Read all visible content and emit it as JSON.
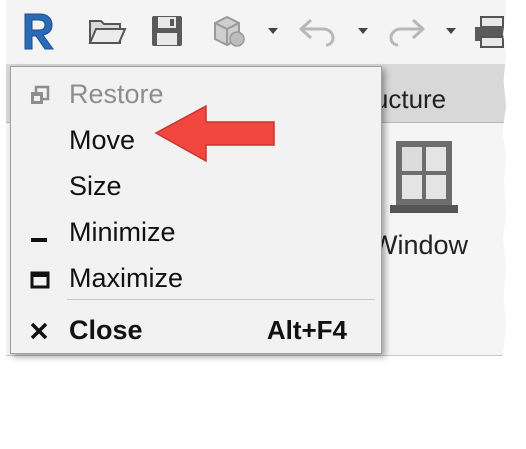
{
  "ribbon": {
    "tab_partial": "tructure",
    "window_label": "Window"
  },
  "system_menu": {
    "items": [
      {
        "label": "Restore",
        "enabled": false
      },
      {
        "label": "Move",
        "enabled": true
      },
      {
        "label": "Size",
        "enabled": true
      },
      {
        "label": "Minimize",
        "enabled": true
      },
      {
        "label": "Maximize",
        "enabled": true
      },
      {
        "label": "Close",
        "enabled": true,
        "shortcut": "Alt+F4"
      }
    ]
  },
  "colors": {
    "revit_logo": "#2a6bb8",
    "arrow": "#f2473f",
    "menu_bg": "#f2f2f2",
    "disabled_text": "#8e8e8e"
  }
}
